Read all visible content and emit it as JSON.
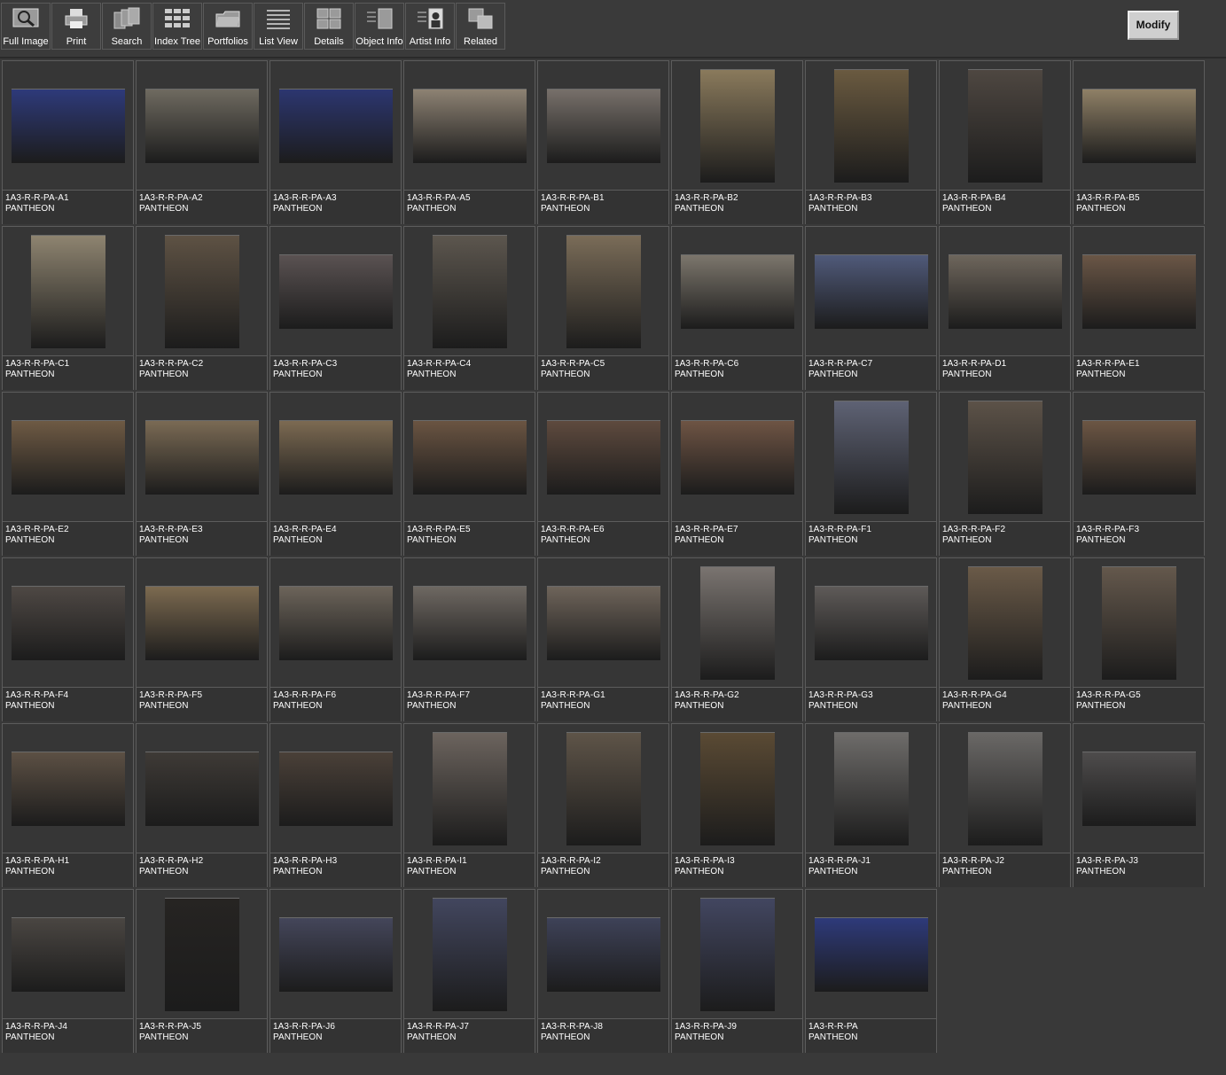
{
  "toolbar": {
    "buttons": [
      {
        "label": "Full Image",
        "icon": "magnifier-icon"
      },
      {
        "label": "Print",
        "icon": "printer-icon"
      },
      {
        "label": "Search",
        "icon": "search-stack-icon"
      },
      {
        "label": "Index Tree",
        "icon": "index-tree-icon"
      },
      {
        "label": "Portfolios",
        "icon": "folder-icon"
      },
      {
        "label": "List View",
        "icon": "list-icon"
      },
      {
        "label": "Details",
        "icon": "details-grid-icon"
      },
      {
        "label": "Object Info",
        "icon": "object-info-icon"
      },
      {
        "label": "Artist  Info",
        "icon": "artist-info-icon"
      },
      {
        "label": "Related",
        "icon": "related-squares-icon"
      }
    ],
    "modify_label": "Modify"
  },
  "colors": {
    "background": "#393939",
    "cell_background": "#363636",
    "cell_border": "#5c5c5c",
    "text": "#ffffff"
  },
  "thumbnails": [
    {
      "id": "1A3-R-R-PA-A1",
      "title": "PANTHEON",
      "orientation": "landscape",
      "tone": "#2e3a7a"
    },
    {
      "id": "1A3-R-R-PA-A2",
      "title": "PANTHEON",
      "orientation": "landscape",
      "tone": "#6f6a60"
    },
    {
      "id": "1A3-R-R-PA-A3",
      "title": "PANTHEON",
      "orientation": "landscape",
      "tone": "#2c3670"
    },
    {
      "id": "1A3-R-R-PA-A5",
      "title": "PANTHEON",
      "orientation": "landscape",
      "tone": "#8d8273"
    },
    {
      "id": "1A3-R-R-PA-B1",
      "title": "PANTHEON",
      "orientation": "landscape",
      "tone": "#77706a"
    },
    {
      "id": "1A3-R-R-PA-B2",
      "title": "PANTHEON",
      "orientation": "portrait",
      "tone": "#8a7a5c"
    },
    {
      "id": "1A3-R-R-PA-B3",
      "title": "PANTHEON",
      "orientation": "portrait",
      "tone": "#6a5a40"
    },
    {
      "id": "1A3-R-R-PA-B4",
      "title": "PANTHEON",
      "orientation": "portrait",
      "tone": "#4e4741"
    },
    {
      "id": "1A3-R-R-PA-B5",
      "title": "PANTHEON",
      "orientation": "landscape",
      "tone": "#8f8066"
    },
    {
      "id": "1A3-R-R-PA-C1",
      "title": "PANTHEON",
      "orientation": "portrait",
      "tone": "#8e8470"
    },
    {
      "id": "1A3-R-R-PA-C2",
      "title": "PANTHEON",
      "orientation": "portrait",
      "tone": "#5e5244"
    },
    {
      "id": "1A3-R-R-PA-C3",
      "title": "PANTHEON",
      "orientation": "landscape",
      "tone": "#5a5252"
    },
    {
      "id": "1A3-R-R-PA-C4",
      "title": "PANTHEON",
      "orientation": "portrait",
      "tone": "#5c564e"
    },
    {
      "id": "1A3-R-R-PA-C5",
      "title": "PANTHEON",
      "orientation": "portrait",
      "tone": "#7a6c58"
    },
    {
      "id": "1A3-R-R-PA-C6",
      "title": "PANTHEON",
      "orientation": "landscape",
      "tone": "#7c766c"
    },
    {
      "id": "1A3-R-R-PA-C7",
      "title": "PANTHEON",
      "orientation": "landscape",
      "tone": "#505a7a"
    },
    {
      "id": "1A3-R-R-PA-D1",
      "title": "PANTHEON",
      "orientation": "landscape",
      "tone": "#6e665c"
    },
    {
      "id": "1A3-R-R-PA-E1",
      "title": "PANTHEON",
      "orientation": "landscape",
      "tone": "#6a5646"
    },
    {
      "id": "1A3-R-R-PA-E2",
      "title": "PANTHEON",
      "orientation": "landscape",
      "tone": "#6e5a44"
    },
    {
      "id": "1A3-R-R-PA-E3",
      "title": "PANTHEON",
      "orientation": "landscape",
      "tone": "#7a6a54"
    },
    {
      "id": "1A3-R-R-PA-E4",
      "title": "PANTHEON",
      "orientation": "landscape",
      "tone": "#7c6a52"
    },
    {
      "id": "1A3-R-R-PA-E5",
      "title": "PANTHEON",
      "orientation": "landscape",
      "tone": "#6a5442"
    },
    {
      "id": "1A3-R-R-PA-E6",
      "title": "PANTHEON",
      "orientation": "landscape",
      "tone": "#5e4a3e"
    },
    {
      "id": "1A3-R-R-PA-E7",
      "title": "PANTHEON",
      "orientation": "landscape",
      "tone": "#6e5444"
    },
    {
      "id": "1A3-R-R-PA-F1",
      "title": "PANTHEON",
      "orientation": "portrait",
      "tone": "#5e6274"
    },
    {
      "id": "1A3-R-R-PA-F2",
      "title": "PANTHEON",
      "orientation": "portrait",
      "tone": "#5c5248"
    },
    {
      "id": "1A3-R-R-PA-F3",
      "title": "PANTHEON",
      "orientation": "landscape",
      "tone": "#6c5644"
    },
    {
      "id": "1A3-R-R-PA-F4",
      "title": "PANTHEON",
      "orientation": "landscape",
      "tone": "#4e4844"
    },
    {
      "id": "1A3-R-R-PA-F5",
      "title": "PANTHEON",
      "orientation": "landscape",
      "tone": "#7c6a50"
    },
    {
      "id": "1A3-R-R-PA-F6",
      "title": "PANTHEON",
      "orientation": "landscape",
      "tone": "#6c645a"
    },
    {
      "id": "1A3-R-R-PA-F7",
      "title": "PANTHEON",
      "orientation": "landscape",
      "tone": "#6e6862"
    },
    {
      "id": "1A3-R-R-PA-G1",
      "title": "PANTHEON",
      "orientation": "landscape",
      "tone": "#6e645a"
    },
    {
      "id": "1A3-R-R-PA-G2",
      "title": "PANTHEON",
      "orientation": "portrait",
      "tone": "#7a7470"
    },
    {
      "id": "1A3-R-R-PA-G3",
      "title": "PANTHEON",
      "orientation": "landscape",
      "tone": "#5e5a58"
    },
    {
      "id": "1A3-R-R-PA-G4",
      "title": "PANTHEON",
      "orientation": "portrait",
      "tone": "#6a5a48"
    },
    {
      "id": "1A3-R-R-PA-G5",
      "title": "PANTHEON",
      "orientation": "portrait",
      "tone": "#64584c"
    },
    {
      "id": "1A3-R-R-PA-H1",
      "title": "PANTHEON",
      "orientation": "landscape",
      "tone": "#5c5044"
    },
    {
      "id": "1A3-R-R-PA-H2",
      "title": "PANTHEON",
      "orientation": "landscape",
      "tone": "#3e3a36"
    },
    {
      "id": "1A3-R-R-PA-H3",
      "title": "PANTHEON",
      "orientation": "landscape",
      "tone": "#4a4038"
    },
    {
      "id": "1A3-R-R-PA-I1",
      "title": "PANTHEON",
      "orientation": "portrait",
      "tone": "#6c645e"
    },
    {
      "id": "1A3-R-R-PA-I2",
      "title": "PANTHEON",
      "orientation": "portrait",
      "tone": "#5e5448"
    },
    {
      "id": "1A3-R-R-PA-I3",
      "title": "PANTHEON",
      "orientation": "portrait",
      "tone": "#5a4a34"
    },
    {
      "id": "1A3-R-R-PA-J1",
      "title": "PANTHEON",
      "orientation": "portrait",
      "tone": "#6e6c6a"
    },
    {
      "id": "1A3-R-R-PA-J2",
      "title": "PANTHEON",
      "orientation": "portrait",
      "tone": "#6a6866"
    },
    {
      "id": "1A3-R-R-PA-J3",
      "title": "PANTHEON",
      "orientation": "landscape",
      "tone": "#4e4c4c"
    },
    {
      "id": "1A3-R-R-PA-J4",
      "title": "PANTHEON",
      "orientation": "landscape",
      "tone": "#4a4642"
    },
    {
      "id": "1A3-R-R-PA-J5",
      "title": "PANTHEON",
      "orientation": "portrait",
      "tone": "#262422"
    },
    {
      "id": "1A3-R-R-PA-J6",
      "title": "PANTHEON",
      "orientation": "landscape",
      "tone": "#44465a"
    },
    {
      "id": "1A3-R-R-PA-J7",
      "title": "PANTHEON",
      "orientation": "portrait",
      "tone": "#42465e"
    },
    {
      "id": "1A3-R-R-PA-J8",
      "title": "PANTHEON",
      "orientation": "landscape",
      "tone": "#3e4258"
    },
    {
      "id": "1A3-R-R-PA-J9",
      "title": "PANTHEON",
      "orientation": "portrait",
      "tone": "#424660"
    },
    {
      "id": "1A3-R-R-PA",
      "title": "PANTHEON",
      "orientation": "landscape",
      "tone": "#2e3a7a"
    }
  ]
}
